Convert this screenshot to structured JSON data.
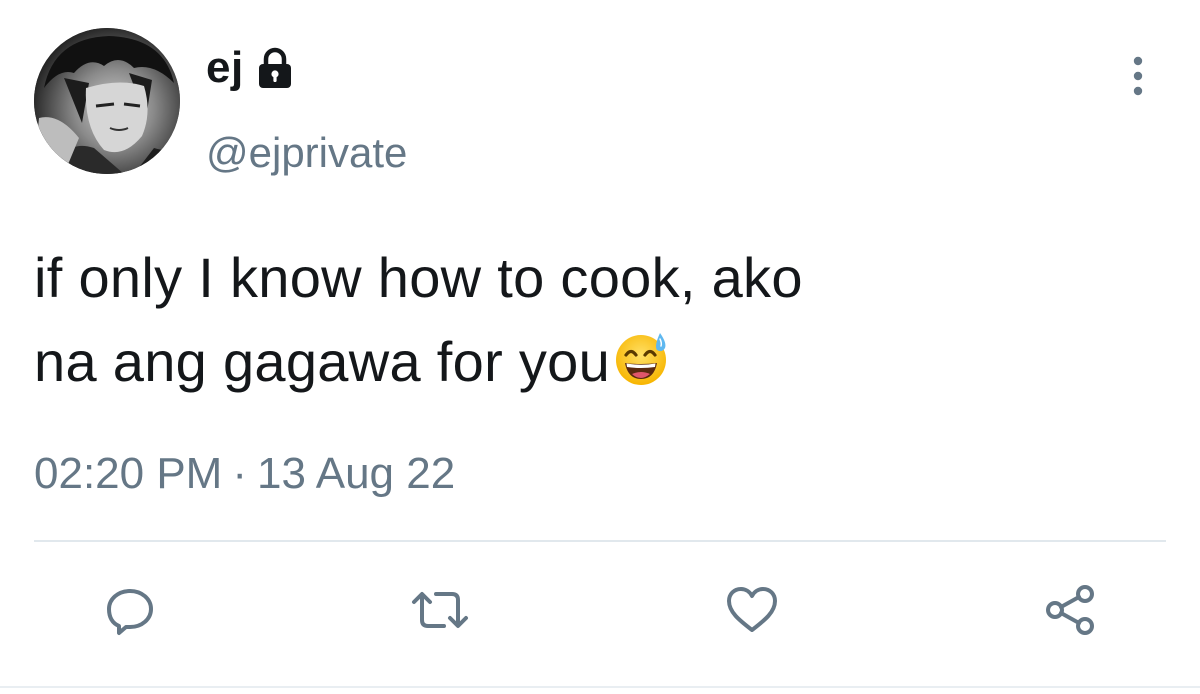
{
  "user": {
    "display_name": "ej",
    "handle": "@ejprivate",
    "protected_icon": "lock-icon",
    "avatar_icon": "avatar"
  },
  "tweet": {
    "line1": "if only I know how to cook, ako",
    "line2": "na ang gagawa for you",
    "emoji": "grinning-face-with-sweat-emoji"
  },
  "meta": {
    "time": "02:20 PM",
    "separator": "·",
    "date": "13 Aug 22"
  },
  "actions": {
    "reply_icon": "reply-icon",
    "retweet_icon": "retweet-icon",
    "like_icon": "heart-icon",
    "share_icon": "share-icon",
    "more_icon": "more-vertical-icon"
  },
  "colors": {
    "text": "#14171a",
    "secondary": "#657786",
    "divider": "#e1e8ed"
  }
}
